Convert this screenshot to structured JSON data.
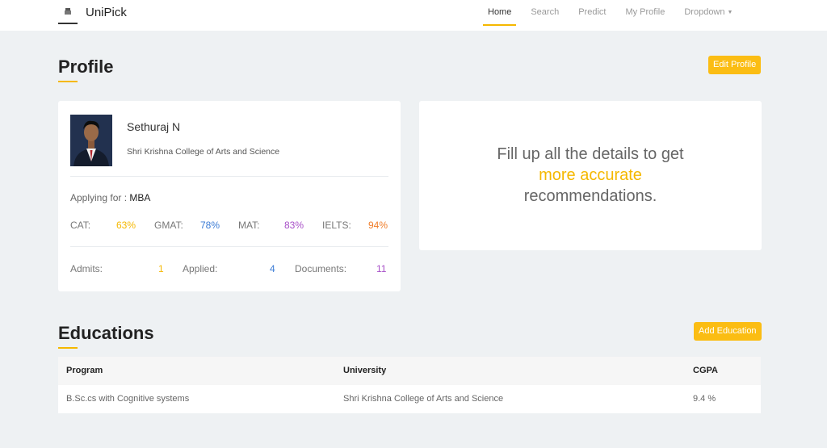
{
  "nav": {
    "brand": "UniPick",
    "links": [
      "Home",
      "Search",
      "Predict",
      "My Profile",
      "Dropdown"
    ]
  },
  "profile": {
    "title": "Profile",
    "edit_button": "Edit Profile",
    "name": "Sethuraj N",
    "college": "Shri Krishna College of Arts and Science",
    "applying_label": "Applying for : ",
    "applying_value": "MBA",
    "scores": [
      {
        "label": "CAT:",
        "value": "63%",
        "color": "#f5b800"
      },
      {
        "label": "GMAT:",
        "value": "78%",
        "color": "#3a7bd5"
      },
      {
        "label": "MAT:",
        "value": "83%",
        "color": "#a74fc7"
      },
      {
        "label": "IELTS:",
        "value": "94%",
        "color": "#f07c28"
      }
    ],
    "stats": [
      {
        "label": "Admits:",
        "value": "1",
        "color": "#f5b800"
      },
      {
        "label": "Applied:",
        "value": "4",
        "color": "#3a7bd5"
      },
      {
        "label": "Documents:",
        "value": "11",
        "color": "#a74fc7"
      }
    ]
  },
  "info": {
    "line1": "Fill up all the details to get",
    "highlight": "more accurate",
    "line3": "recommendations."
  },
  "education": {
    "title": "Educations",
    "add_button": "Add Education",
    "headers": [
      "Program",
      "University",
      "CGPA"
    ],
    "rows": [
      [
        "B.Sc.cs with Cognitive systems",
        "Shri Krishna College of Arts and Science",
        "9.4 %"
      ]
    ]
  },
  "colors": {
    "accent": "#fbbd13",
    "background": "#eef1f3"
  }
}
